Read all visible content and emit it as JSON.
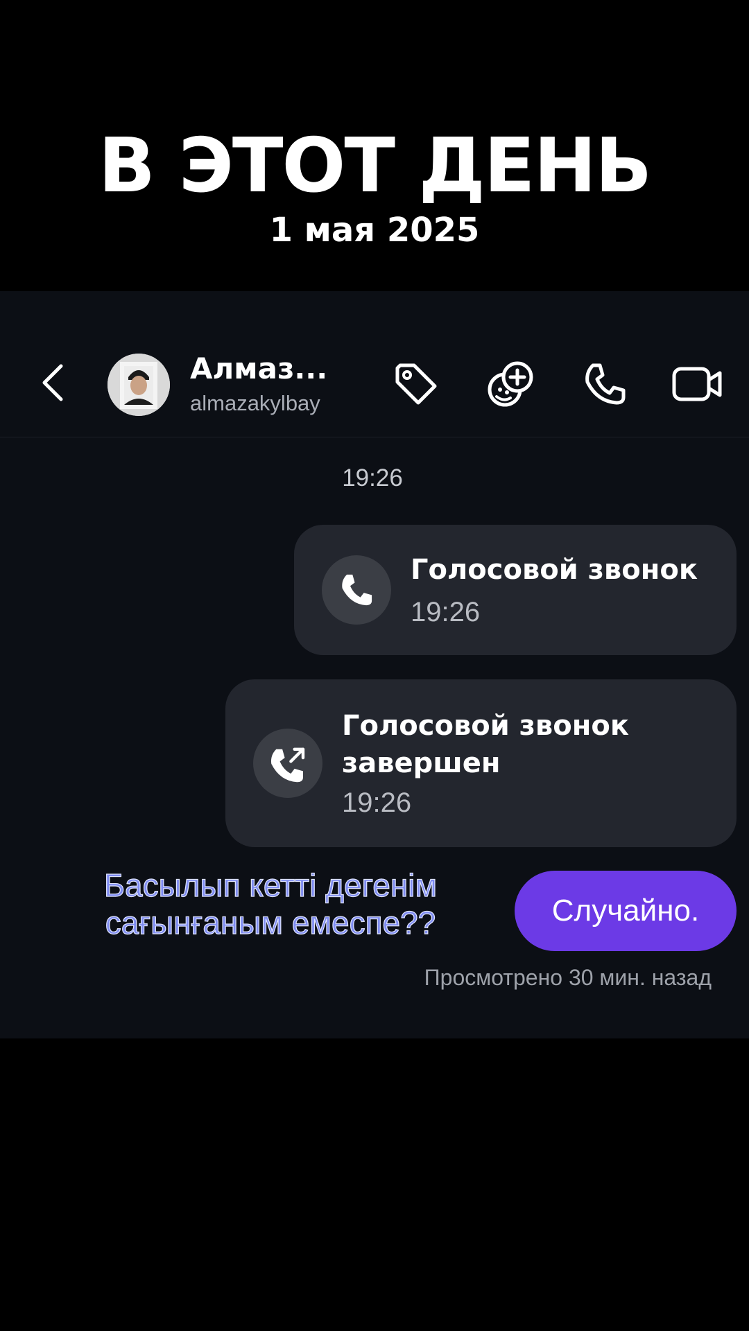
{
  "overlay": {
    "headline": "В ЭТОТ ДЕНЬ",
    "date": "1 мая 2025",
    "caption": "Басылып кетті дегенім сағынғаным емеспе??"
  },
  "header": {
    "back_icon": "chevron-left-icon",
    "contact_name": "Алмаз...",
    "contact_username": "almazakylbay",
    "actions": [
      {
        "name": "tag-icon"
      },
      {
        "name": "add-effect-icon"
      },
      {
        "name": "phone-icon"
      },
      {
        "name": "video-camera-icon"
      }
    ]
  },
  "chat": {
    "timestamp": "19:26",
    "messages": [
      {
        "type": "call",
        "icon": "phone-icon",
        "title": "Голосовой звонок",
        "time": "19:26"
      },
      {
        "type": "call",
        "icon": "outgoing-call-icon",
        "title": "Голосовой звонок завершен",
        "time": "19:26"
      },
      {
        "type": "text",
        "text": "Случайно."
      }
    ],
    "seen_status": "Просмотрено 30 мин. назад"
  },
  "colors": {
    "background": "#000000",
    "chat_background": "#0c0f15",
    "bubble": "#23262e",
    "accent_bubble": "#6c3ae6",
    "caption_text": "#7f8cf1"
  }
}
